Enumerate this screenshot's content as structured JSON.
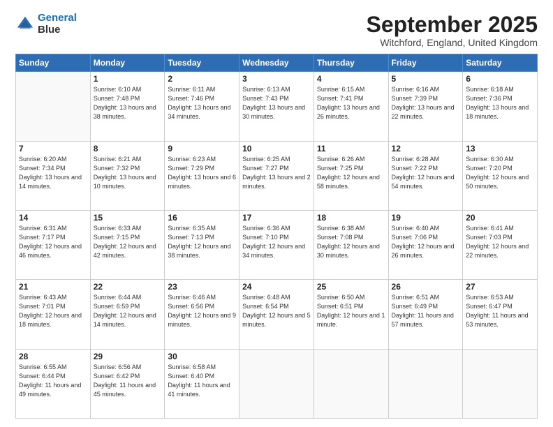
{
  "header": {
    "logo_line1": "General",
    "logo_line2": "Blue",
    "month": "September 2025",
    "location": "Witchford, England, United Kingdom"
  },
  "days_of_week": [
    "Sunday",
    "Monday",
    "Tuesday",
    "Wednesday",
    "Thursday",
    "Friday",
    "Saturday"
  ],
  "weeks": [
    [
      {
        "day": "",
        "sunrise": "",
        "sunset": "",
        "daylight": ""
      },
      {
        "day": "1",
        "sunrise": "Sunrise: 6:10 AM",
        "sunset": "Sunset: 7:48 PM",
        "daylight": "Daylight: 13 hours and 38 minutes."
      },
      {
        "day": "2",
        "sunrise": "Sunrise: 6:11 AM",
        "sunset": "Sunset: 7:46 PM",
        "daylight": "Daylight: 13 hours and 34 minutes."
      },
      {
        "day": "3",
        "sunrise": "Sunrise: 6:13 AM",
        "sunset": "Sunset: 7:43 PM",
        "daylight": "Daylight: 13 hours and 30 minutes."
      },
      {
        "day": "4",
        "sunrise": "Sunrise: 6:15 AM",
        "sunset": "Sunset: 7:41 PM",
        "daylight": "Daylight: 13 hours and 26 minutes."
      },
      {
        "day": "5",
        "sunrise": "Sunrise: 6:16 AM",
        "sunset": "Sunset: 7:39 PM",
        "daylight": "Daylight: 13 hours and 22 minutes."
      },
      {
        "day": "6",
        "sunrise": "Sunrise: 6:18 AM",
        "sunset": "Sunset: 7:36 PM",
        "daylight": "Daylight: 13 hours and 18 minutes."
      }
    ],
    [
      {
        "day": "7",
        "sunrise": "Sunrise: 6:20 AM",
        "sunset": "Sunset: 7:34 PM",
        "daylight": "Daylight: 13 hours and 14 minutes."
      },
      {
        "day": "8",
        "sunrise": "Sunrise: 6:21 AM",
        "sunset": "Sunset: 7:32 PM",
        "daylight": "Daylight: 13 hours and 10 minutes."
      },
      {
        "day": "9",
        "sunrise": "Sunrise: 6:23 AM",
        "sunset": "Sunset: 7:29 PM",
        "daylight": "Daylight: 13 hours and 6 minutes."
      },
      {
        "day": "10",
        "sunrise": "Sunrise: 6:25 AM",
        "sunset": "Sunset: 7:27 PM",
        "daylight": "Daylight: 13 hours and 2 minutes."
      },
      {
        "day": "11",
        "sunrise": "Sunrise: 6:26 AM",
        "sunset": "Sunset: 7:25 PM",
        "daylight": "Daylight: 12 hours and 58 minutes."
      },
      {
        "day": "12",
        "sunrise": "Sunrise: 6:28 AM",
        "sunset": "Sunset: 7:22 PM",
        "daylight": "Daylight: 12 hours and 54 minutes."
      },
      {
        "day": "13",
        "sunrise": "Sunrise: 6:30 AM",
        "sunset": "Sunset: 7:20 PM",
        "daylight": "Daylight: 12 hours and 50 minutes."
      }
    ],
    [
      {
        "day": "14",
        "sunrise": "Sunrise: 6:31 AM",
        "sunset": "Sunset: 7:17 PM",
        "daylight": "Daylight: 12 hours and 46 minutes."
      },
      {
        "day": "15",
        "sunrise": "Sunrise: 6:33 AM",
        "sunset": "Sunset: 7:15 PM",
        "daylight": "Daylight: 12 hours and 42 minutes."
      },
      {
        "day": "16",
        "sunrise": "Sunrise: 6:35 AM",
        "sunset": "Sunset: 7:13 PM",
        "daylight": "Daylight: 12 hours and 38 minutes."
      },
      {
        "day": "17",
        "sunrise": "Sunrise: 6:36 AM",
        "sunset": "Sunset: 7:10 PM",
        "daylight": "Daylight: 12 hours and 34 minutes."
      },
      {
        "day": "18",
        "sunrise": "Sunrise: 6:38 AM",
        "sunset": "Sunset: 7:08 PM",
        "daylight": "Daylight: 12 hours and 30 minutes."
      },
      {
        "day": "19",
        "sunrise": "Sunrise: 6:40 AM",
        "sunset": "Sunset: 7:06 PM",
        "daylight": "Daylight: 12 hours and 26 minutes."
      },
      {
        "day": "20",
        "sunrise": "Sunrise: 6:41 AM",
        "sunset": "Sunset: 7:03 PM",
        "daylight": "Daylight: 12 hours and 22 minutes."
      }
    ],
    [
      {
        "day": "21",
        "sunrise": "Sunrise: 6:43 AM",
        "sunset": "Sunset: 7:01 PM",
        "daylight": "Daylight: 12 hours and 18 minutes."
      },
      {
        "day": "22",
        "sunrise": "Sunrise: 6:44 AM",
        "sunset": "Sunset: 6:59 PM",
        "daylight": "Daylight: 12 hours and 14 minutes."
      },
      {
        "day": "23",
        "sunrise": "Sunrise: 6:46 AM",
        "sunset": "Sunset: 6:56 PM",
        "daylight": "Daylight: 12 hours and 9 minutes."
      },
      {
        "day": "24",
        "sunrise": "Sunrise: 6:48 AM",
        "sunset": "Sunset: 6:54 PM",
        "daylight": "Daylight: 12 hours and 5 minutes."
      },
      {
        "day": "25",
        "sunrise": "Sunrise: 6:50 AM",
        "sunset": "Sunset: 6:51 PM",
        "daylight": "Daylight: 12 hours and 1 minute."
      },
      {
        "day": "26",
        "sunrise": "Sunrise: 6:51 AM",
        "sunset": "Sunset: 6:49 PM",
        "daylight": "Daylight: 11 hours and 57 minutes."
      },
      {
        "day": "27",
        "sunrise": "Sunrise: 6:53 AM",
        "sunset": "Sunset: 6:47 PM",
        "daylight": "Daylight: 11 hours and 53 minutes."
      }
    ],
    [
      {
        "day": "28",
        "sunrise": "Sunrise: 6:55 AM",
        "sunset": "Sunset: 6:44 PM",
        "daylight": "Daylight: 11 hours and 49 minutes."
      },
      {
        "day": "29",
        "sunrise": "Sunrise: 6:56 AM",
        "sunset": "Sunset: 6:42 PM",
        "daylight": "Daylight: 11 hours and 45 minutes."
      },
      {
        "day": "30",
        "sunrise": "Sunrise: 6:58 AM",
        "sunset": "Sunset: 6:40 PM",
        "daylight": "Daylight: 11 hours and 41 minutes."
      },
      {
        "day": "",
        "sunrise": "",
        "sunset": "",
        "daylight": ""
      },
      {
        "day": "",
        "sunrise": "",
        "sunset": "",
        "daylight": ""
      },
      {
        "day": "",
        "sunrise": "",
        "sunset": "",
        "daylight": ""
      },
      {
        "day": "",
        "sunrise": "",
        "sunset": "",
        "daylight": ""
      }
    ]
  ]
}
